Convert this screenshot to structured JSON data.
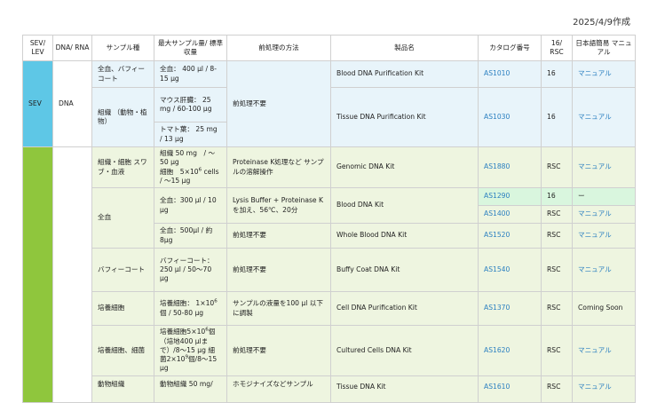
{
  "date": "2025/4/9作成",
  "headers": {
    "level": "SEV/ LEV",
    "dna_rna": "DNA/ RNA",
    "sample": "サンプル種",
    "max_amount": "最大サンプル量/ 標準収量",
    "pretreatment": "前処理の方法",
    "product": "製品名",
    "catalog": "カタログ番号",
    "rsc": "16/ RSC",
    "manual": "日本語簡易 マニュアル"
  },
  "level_sev": "SEV",
  "level_rsc": "",
  "dna": "DNA",
  "rows": [
    {
      "sample": "全血、バフィーコート",
      "amount": "全血： 400 µl / 8-15 µg",
      "pre": "前処理不要",
      "product": "Blood DNA Purification Kit",
      "catalog": "AS1010",
      "rsc": "16",
      "manual": "マニュアル"
    },
    {
      "sample": "組織 （動物・植物）",
      "amount_a": "マウス肝臓： 25 mg / 60-100 µg",
      "amount_b": "トマト葉： 25 mg / 13 µg",
      "product": "Tissue DNA Purification Kit",
      "catalog": "AS1030",
      "rsc": "16",
      "manual": "マニュアル"
    },
    {
      "sample": "組織・細胞 スワブ・血液",
      "amount_1": "組織 50 mg　/ ～50 µg",
      "amount_2": "細胞　5×10",
      "amount_2_sup": "6",
      "amount_3": " cells / ～15 µg",
      "pre": "Proteinase K処理など サンプルの溶解操作",
      "product": "Genomic DNA Kit",
      "catalog": "AS1880",
      "rsc": "RSC",
      "manual": "マニュアル"
    },
    {
      "sample": "全血",
      "amount": "全血：300 µl / 10 µg",
      "pre": "Lysis Buffer + Proteinase K を加え、56℃、20分",
      "product": "Blood DNA Kit",
      "catalog": "AS1290",
      "rsc": "16",
      "manual": "ー"
    },
    {
      "catalog": "AS1400",
      "rsc": "RSC",
      "manual": "マニュアル"
    },
    {
      "amount": "全血：500µl / 約8µg",
      "pre": "前処理不要",
      "product": "Whole Blood DNA Kit",
      "catalog": "AS1520",
      "rsc": "RSC",
      "manual": "マニュアル"
    },
    {
      "sample": "バフィーコート",
      "amount": "バフィーコート： 250 µl / 50～70 µg",
      "pre": "前処理不要",
      "product": "Buffy Coat DNA Kit",
      "catalog": "AS1540",
      "rsc": "RSC",
      "manual": "マニュアル"
    },
    {
      "sample": "培養細胞",
      "amount_a": "培養細胞： 1×10",
      "amount_sup": "6",
      "amount_b": "個 / 50-80 µg",
      "pre": "サンプルの液量を100 µl 以下に調製",
      "product": "Cell DNA Purification Kit",
      "catalog": "AS1370",
      "rsc": "RSC",
      "manual": "Coming Soon"
    },
    {
      "sample": "培養細胞、細菌",
      "amount_a": "培養細胞5×10",
      "amount_sup1": "6",
      "amount_b": "個（培地400 µlまで）/8～15 µg",
      "amount_c": "細菌2×10",
      "amount_sup2": "9",
      "amount_d": "個/8～15 µg",
      "pre": "前処理不要",
      "product": "Cultured Cells DNA Kit",
      "catalog": "AS1620",
      "rsc": "RSC",
      "manual": "マニュアル"
    },
    {
      "sample": "動物組織",
      "amount": "動物組織 50 mg/",
      "pre": "ホモジナイズなどサンプル",
      "product": "Tissue DNA Kit",
      "catalog": "AS1610",
      "rsc": "RSC",
      "manual": "マニュアル"
    }
  ],
  "colors": {
    "sev_level": "#5ec7e6",
    "rsc_level": "#8fc63d",
    "sev_row": "#e8f4fa",
    "rsc_row": "#eef5e0",
    "highlight": "#d9f6de",
    "link": "#2a7fc0"
  }
}
